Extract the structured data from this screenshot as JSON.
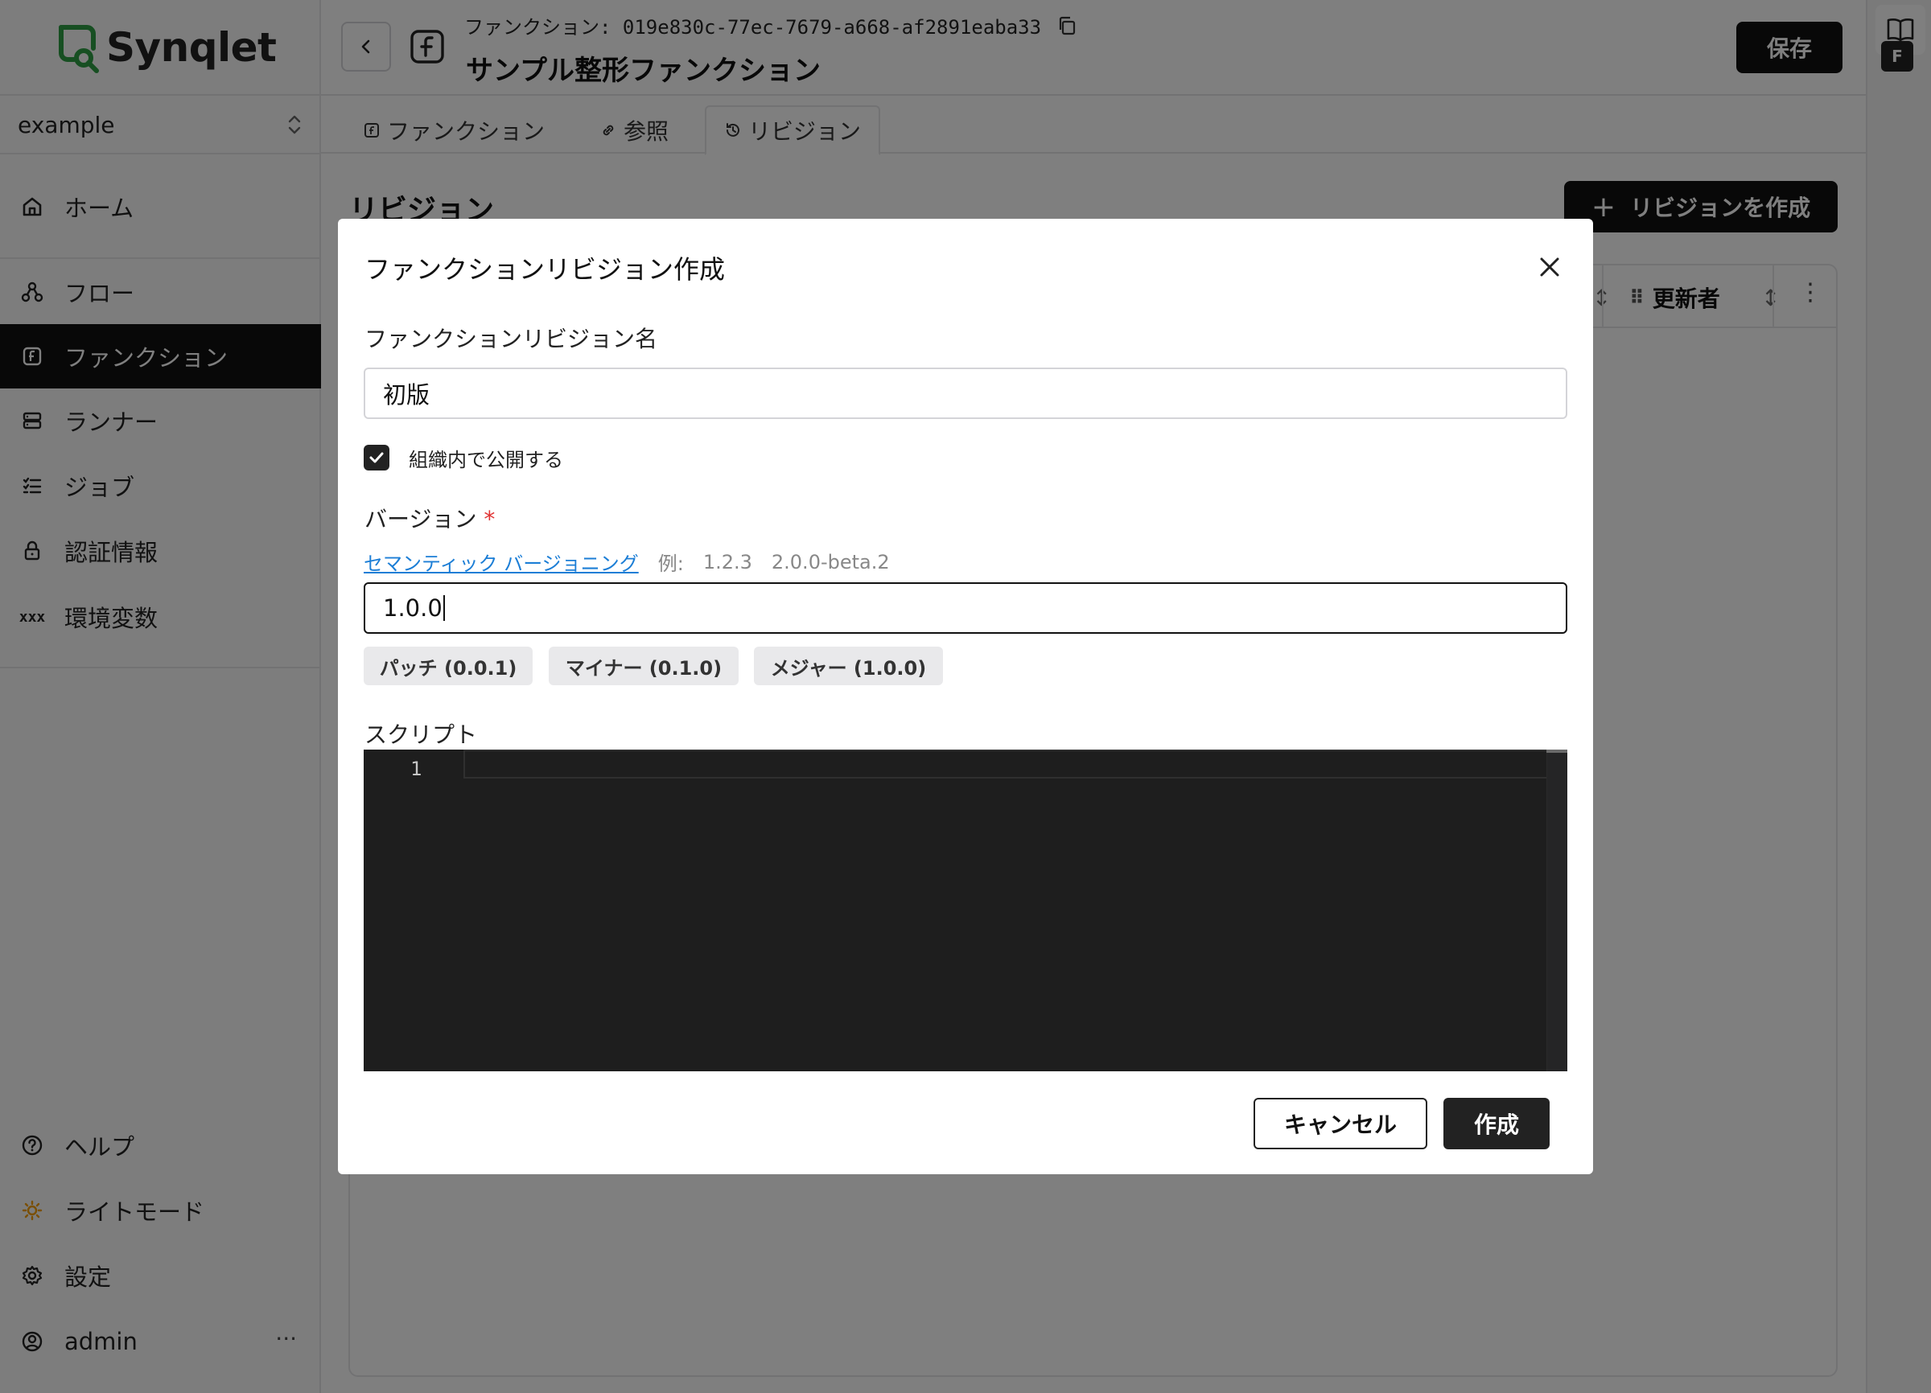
{
  "app": {
    "brand": "Synqlet"
  },
  "sidebar": {
    "org": "example",
    "items": [
      {
        "label": "ホーム",
        "icon": "home-icon"
      },
      {
        "label": "フロー",
        "icon": "flow-icon"
      },
      {
        "label": "ファンクション",
        "icon": "function-icon",
        "active": true
      },
      {
        "label": "ランナー",
        "icon": "server-icon"
      },
      {
        "label": "ジョブ",
        "icon": "list-icon"
      },
      {
        "label": "認証情報",
        "icon": "lock-icon"
      },
      {
        "label": "環境変数",
        "icon": "variable-icon",
        "glyph": "xxx"
      }
    ],
    "footer": [
      {
        "label": "ヘルプ",
        "icon": "help-icon"
      },
      {
        "label": "ライトモード",
        "icon": "sun-icon"
      },
      {
        "label": "設定",
        "icon": "gear-icon"
      },
      {
        "label": "admin",
        "icon": "user-icon",
        "more": "···"
      }
    ]
  },
  "header": {
    "id_label": "ファンクション: 019e830c-77ec-7679-a668-af2891eaba33",
    "name": "サンプル整形ファンクション",
    "save": "保存"
  },
  "tabs": [
    {
      "label": "ファンクション",
      "icon": "function-icon"
    },
    {
      "label": "参照",
      "icon": "link-icon"
    },
    {
      "label": "リビジョン",
      "icon": "history-icon",
      "active": true
    }
  ],
  "main": {
    "title": "リビジョン",
    "create_button": "リビジョンを作成",
    "plus": "+",
    "table_headers": {
      "updater": "更新者",
      "grip": "⠿",
      "sort": "↕",
      "menu": "⋮"
    }
  },
  "rail": {
    "badge": "F"
  },
  "modal": {
    "title": "ファンクションリビジョン作成",
    "name_label": "ファンクションリビジョン名",
    "name_value": "初版",
    "publish_label": "組織内で公開する",
    "publish_checked": true,
    "version_label": "バージョン",
    "required_mark": "*",
    "semver_link": "セマンティック バージョニング",
    "example_label": "例:",
    "examples": [
      "1.2.3",
      "2.0.0-beta.2"
    ],
    "version_value": "1.0.0",
    "bumps": [
      "パッチ (0.0.1)",
      "マイナー (0.1.0)",
      "メジャー (1.0.0)"
    ],
    "script_label": "スクリプト",
    "line_number": "1",
    "cancel": "キャンセル",
    "create": "作成"
  },
  "colors": {
    "accent": "#111111",
    "link": "#1c7ed6",
    "required": "#e03131",
    "brand_green": "#2f9e44",
    "overlay": "rgba(0,0,0,0.5)"
  }
}
